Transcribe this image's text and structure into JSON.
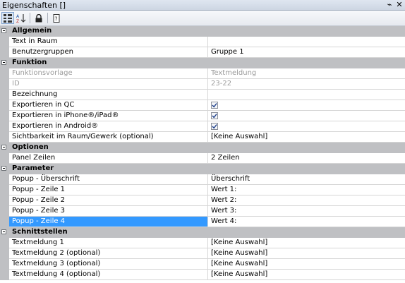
{
  "window": {
    "title": "Eigenschaften []",
    "pin_glyph": "⌁",
    "close_glyph": "✕"
  },
  "toolbar": {
    "buttons": [
      {
        "icon": "categorized-view-icon",
        "active": true
      },
      {
        "icon": "alphabetical-sort-icon",
        "active": false
      },
      {
        "icon": "lock-icon",
        "active": false
      },
      {
        "icon": "property-pages-icon",
        "active": false
      }
    ]
  },
  "sections": [
    {
      "label": "Allgemein",
      "rows": [
        {
          "name": "Text in Raum",
          "value": ""
        },
        {
          "name": "Benutzergruppen",
          "value": "Gruppe 1"
        }
      ]
    },
    {
      "label": "Funktion",
      "rows": [
        {
          "name": "Funktionsvorlage",
          "value": "Textmeldung",
          "disabled": true
        },
        {
          "name": "ID",
          "value": "23-22",
          "disabled": true
        },
        {
          "name": "Bezeichnung",
          "value": ""
        },
        {
          "name": "Exportieren in QC",
          "value": "",
          "checkbox": true,
          "checked": true
        },
        {
          "name": "Exportieren in iPhone®/iPad®",
          "value": "",
          "checkbox": true,
          "checked": true
        },
        {
          "name": "Exportieren in Android®",
          "value": "",
          "checkbox": true,
          "checked": true
        },
        {
          "name": "Sichtbarkeit im Raum/Gewerk (optional)",
          "value": "[Keine Auswahl]"
        }
      ]
    },
    {
      "label": "Optionen",
      "rows": [
        {
          "name": "Panel Zeilen",
          "value": "2 Zeilen"
        }
      ]
    },
    {
      "label": "Parameter",
      "rows": [
        {
          "name": "Popup - Überschrift",
          "value": "Überschrift"
        },
        {
          "name": "Popup - Zeile 1",
          "value": "Wert 1:"
        },
        {
          "name": "Popup - Zeile 2",
          "value": "Wert 2:"
        },
        {
          "name": "Popup - Zeile 3",
          "value": "Wert 3:"
        },
        {
          "name": "Popup - Zeile 4",
          "value": "Wert 4:",
          "selected": true
        }
      ]
    },
    {
      "label": "Schnittstellen",
      "rows": [
        {
          "name": "Textmeldung 1",
          "value": "[Keine Auswahl]"
        },
        {
          "name": "Textmeldung 2 (optional)",
          "value": "[Keine Auswahl]"
        },
        {
          "name": "Textmeldung 3 (optional)",
          "value": "[Keine Auswahl]"
        },
        {
          "name": "Textmeldung 4 (optional)",
          "value": "[Keine Auswahl]"
        }
      ]
    }
  ]
}
